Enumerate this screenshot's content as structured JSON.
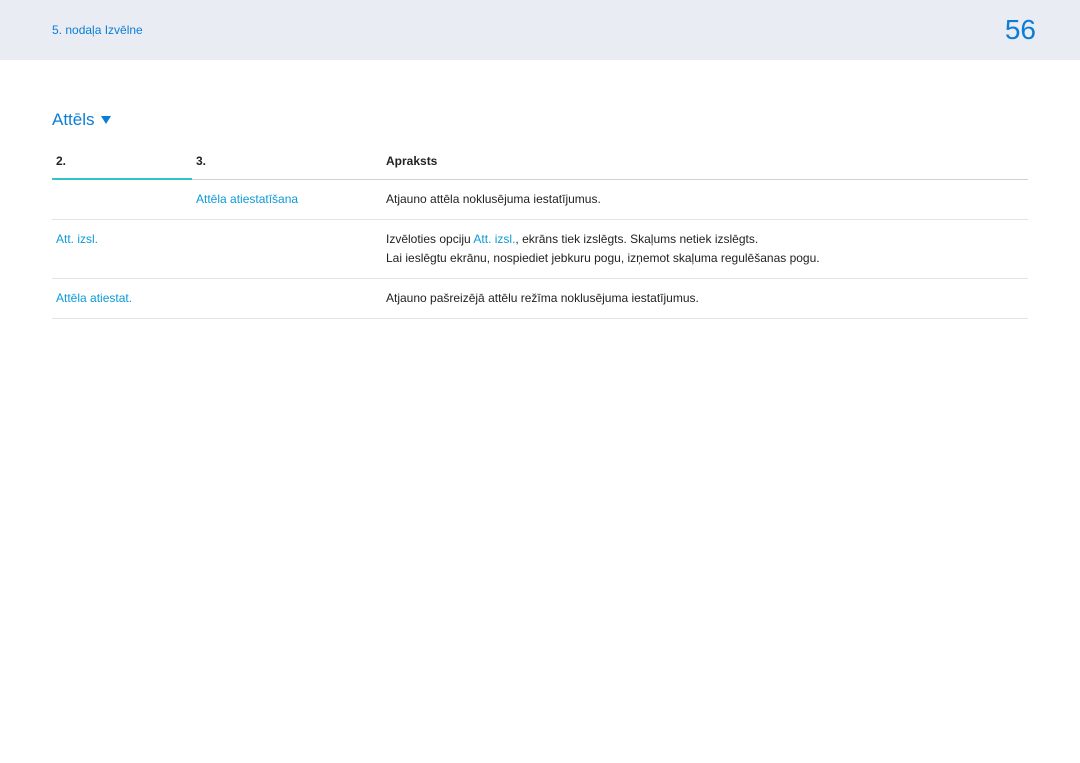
{
  "header": {
    "breadcrumb": "5. nodaļa Izvēlne",
    "page_number": "56"
  },
  "section": {
    "title": "Attēls"
  },
  "table": {
    "headers": {
      "col2": "2.",
      "col3": "3.",
      "desc": "Apraksts"
    },
    "rows": [
      {
        "col2": "",
        "col3": "Attēla atiestatīšana",
        "desc": "Atjauno attēla noklusējuma iestatījumus."
      },
      {
        "col2": "Att. izsl.",
        "col3": "",
        "desc_prefix": "Izvēloties opciju ",
        "desc_link": "Att. izsl.",
        "desc_suffix": ", ekrāns tiek izslēgts. Skaļums netiek izslēgts.",
        "desc_line2": "Lai ieslēgtu ekrānu, nospiediet jebkuru pogu, izņemot skaļuma regulēšanas pogu."
      },
      {
        "col2": "Attēla atiestat.",
        "col3": "",
        "desc": "Atjauno pašreizējā attēlu režīma noklusējuma iestatījumus."
      }
    ]
  }
}
